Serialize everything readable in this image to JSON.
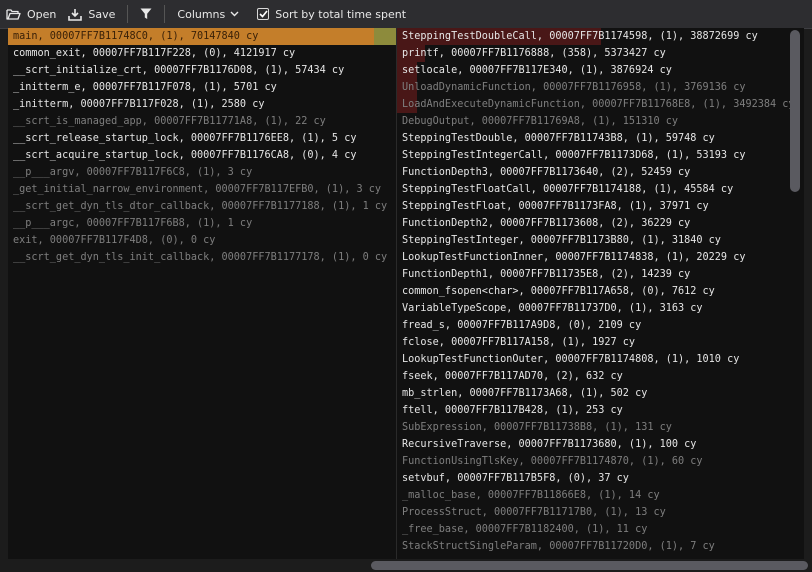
{
  "toolbar": {
    "open_label": "Open",
    "save_label": "Save",
    "columns_label": "Columns",
    "sort_label": "Sort by total time spent",
    "sort_checked": true
  },
  "left_rows": [
    {
      "text": "main, 00007FF7B11748C0, (1), 70147840 cy",
      "dim": false,
      "selected": true
    },
    {
      "text": "common_exit, 00007FF7B117F228, (0), 4121917 cy",
      "dim": false
    },
    {
      "text": "__scrt_initialize_crt, 00007FF7B1176D08, (1), 57434 cy",
      "dim": false
    },
    {
      "text": "_initterm_e, 00007FF7B117F078, (1), 5701 cy",
      "dim": false
    },
    {
      "text": "_initterm, 00007FF7B117F028, (1), 2580 cy",
      "dim": false
    },
    {
      "text": "__scrt_is_managed_app, 00007FF7B11771A8, (1), 22 cy",
      "dim": true
    },
    {
      "text": "__scrt_release_startup_lock, 00007FF7B1176EE8, (1), 5 cy",
      "dim": false
    },
    {
      "text": "__scrt_acquire_startup_lock, 00007FF7B1176CA8, (0), 4 cy",
      "dim": false
    },
    {
      "text": "__p___argv, 00007FF7B117F6C8, (1), 3 cy",
      "dim": true
    },
    {
      "text": "_get_initial_narrow_environment, 00007FF7B117EFB0, (1), 3 cy",
      "dim": true
    },
    {
      "text": "__scrt_get_dyn_tls_dtor_callback, 00007FF7B1177188, (1), 1 cy",
      "dim": true
    },
    {
      "text": "__p___argc, 00007FF7B117F6B8, (1), 1 cy",
      "dim": true
    },
    {
      "text": "exit, 00007FF7B117F4D8, (0), 0 cy",
      "dim": true
    },
    {
      "text": "__scrt_get_dyn_tls_init_callback, 00007FF7B1177178, (1), 0 cy",
      "dim": true
    }
  ],
  "right_rows": [
    {
      "text": "SteppingTestDoubleCall, 00007FF7B1174598, (1), 38872699 cy",
      "dim": false,
      "heat": 0.5
    },
    {
      "text": "printf, 00007FF7B1176888, (358), 5373427 cy",
      "dim": false,
      "heat": 0.07
    },
    {
      "text": "setlocale, 00007FF7B117E340, (1), 3876924 cy",
      "dim": false,
      "heat": 0.05
    },
    {
      "text": "UnloadDynamicFunction, 00007FF7B1176958, (1), 3769136 cy",
      "dim": true,
      "heat": 0.05
    },
    {
      "text": "LoadAndExecuteDynamicFunction, 00007FF7B11768E8, (1), 3492384 cy",
      "dim": true,
      "heat": 0.05
    },
    {
      "text": "DebugOutput, 00007FF7B11769A8, (1), 151310 cy",
      "dim": true
    },
    {
      "text": "SteppingTestDouble, 00007FF7B11743B8, (1), 59748 cy",
      "dim": false
    },
    {
      "text": "SteppingTestIntegerCall, 00007FF7B1173D68, (1), 53193 cy",
      "dim": false
    },
    {
      "text": "FunctionDepth3, 00007FF7B1173640, (2), 52459 cy",
      "dim": false
    },
    {
      "text": "SteppingTestFloatCall, 00007FF7B1174188, (1), 45584 cy",
      "dim": false
    },
    {
      "text": "SteppingTestFloat, 00007FF7B1173FA8, (1), 37971 cy",
      "dim": false
    },
    {
      "text": "FunctionDepth2, 00007FF7B1173608, (2), 36229 cy",
      "dim": false
    },
    {
      "text": "SteppingTestInteger, 00007FF7B1173B80, (1), 31840 cy",
      "dim": false
    },
    {
      "text": "LookupTestFunctionInner, 00007FF7B1174838, (1), 20229 cy",
      "dim": false
    },
    {
      "text": "FunctionDepth1, 00007FF7B11735E8, (2), 14239 cy",
      "dim": false
    },
    {
      "text": "common_fsopen<char>, 00007FF7B117A658, (0), 7612 cy",
      "dim": false
    },
    {
      "text": "VariableTypeScope, 00007FF7B11737D0, (1), 3163 cy",
      "dim": false
    },
    {
      "text": "fread_s, 00007FF7B117A9D8, (0), 2109 cy",
      "dim": false
    },
    {
      "text": "fclose, 00007FF7B117A158, (1), 1927 cy",
      "dim": false
    },
    {
      "text": "LookupTestFunctionOuter, 00007FF7B1174808, (1), 1010 cy",
      "dim": false
    },
    {
      "text": "fseek, 00007FF7B117AD70, (2), 632 cy",
      "dim": false
    },
    {
      "text": "mb_strlen, 00007FF7B1173A68, (1), 502 cy",
      "dim": false
    },
    {
      "text": "ftell, 00007FF7B117B428, (1), 253 cy",
      "dim": false
    },
    {
      "text": "SubExpression, 00007FF7B11738B8, (1), 131 cy",
      "dim": true
    },
    {
      "text": "RecursiveTraverse, 00007FF7B1173680, (1), 100 cy",
      "dim": false
    },
    {
      "text": "FunctionUsingTlsKey, 00007FF7B1174870, (1), 60 cy",
      "dim": true
    },
    {
      "text": "setvbuf, 00007FF7B117B5F8, (0), 37 cy",
      "dim": false
    },
    {
      "text": "_malloc_base, 00007FF7B11866E8, (1), 14 cy",
      "dim": true
    },
    {
      "text": "ProcessStruct, 00007FF7B11717B0, (1), 13 cy",
      "dim": true
    },
    {
      "text": "_free_base, 00007FF7B1182400, (1), 11 cy",
      "dim": true
    },
    {
      "text": "StackStructSingleParam, 00007FF7B11720D0, (1), 7 cy",
      "dim": true
    }
  ]
}
